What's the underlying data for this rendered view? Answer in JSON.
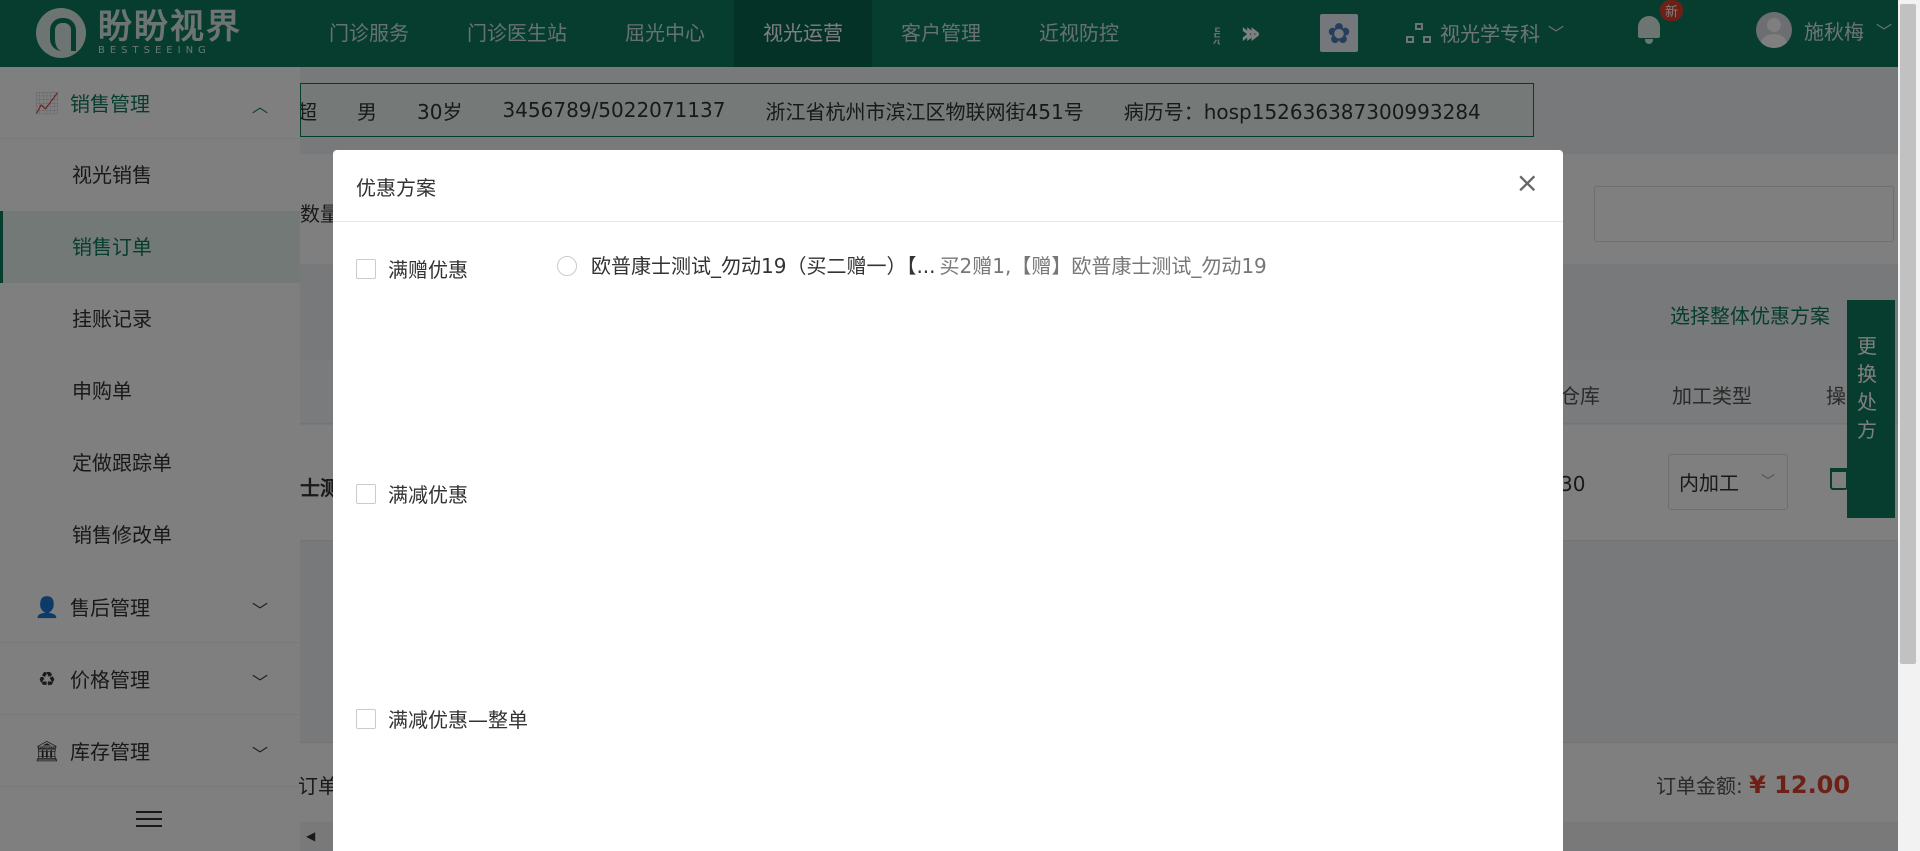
{
  "app": {
    "logo_cn": "盼盼视界",
    "logo_en": "BESTSEEING"
  },
  "nav": {
    "items": [
      "门诊服务",
      "门诊医生站",
      "屈光中心",
      "视光运营",
      "客户管理",
      "近视防控"
    ],
    "active_index": 3,
    "more_icon": "double-chevron-right-icon",
    "cut_item": "患",
    "dept": "视光学专科",
    "notif_badge": "新",
    "user_name": "施秋梅"
  },
  "sidebar": {
    "sales_group": "销售管理",
    "sales_items": [
      "视光销售",
      "销售订单",
      "挂账记录",
      "申购单",
      "定做跟踪单",
      "销售修改单"
    ],
    "active_item": "销售订单",
    "other_groups": [
      "售后管理",
      "价格管理",
      "库存管理"
    ]
  },
  "patient": {
    "name_partial": "超",
    "gender": "男",
    "age": "30岁",
    "phones": "3456789/5022071137",
    "address": "浙江省杭州市滨江区物联网街451号",
    "record": "病历号：hosp152636387300993284"
  },
  "page": {
    "qty_label": "数量",
    "colon": ":",
    "select_whole_plan": "选择整体优惠方案",
    "headers": {
      "warehouse": "仓库",
      "process_type": "加工类型",
      "operation": "操"
    },
    "row": {
      "product_partial": "士测",
      "num_partial": "30",
      "process_value": "内加工"
    },
    "side_tab": "更换处方",
    "footer_left": "订单",
    "total_label": "订单金额:",
    "total_value": "¥ 12.00"
  },
  "modal": {
    "title": "优惠方案",
    "close": "×",
    "options": [
      "满赠优惠",
      "满减优惠",
      "满减优惠—整单"
    ],
    "plan_name": "欧普康士测试_勿动19（买二赠一）【...",
    "plan_desc": "买2赠1,【赠】欧普康士测试_勿动19"
  },
  "colors": {
    "brand": "#0e7a5f",
    "price": "#d9412d"
  }
}
